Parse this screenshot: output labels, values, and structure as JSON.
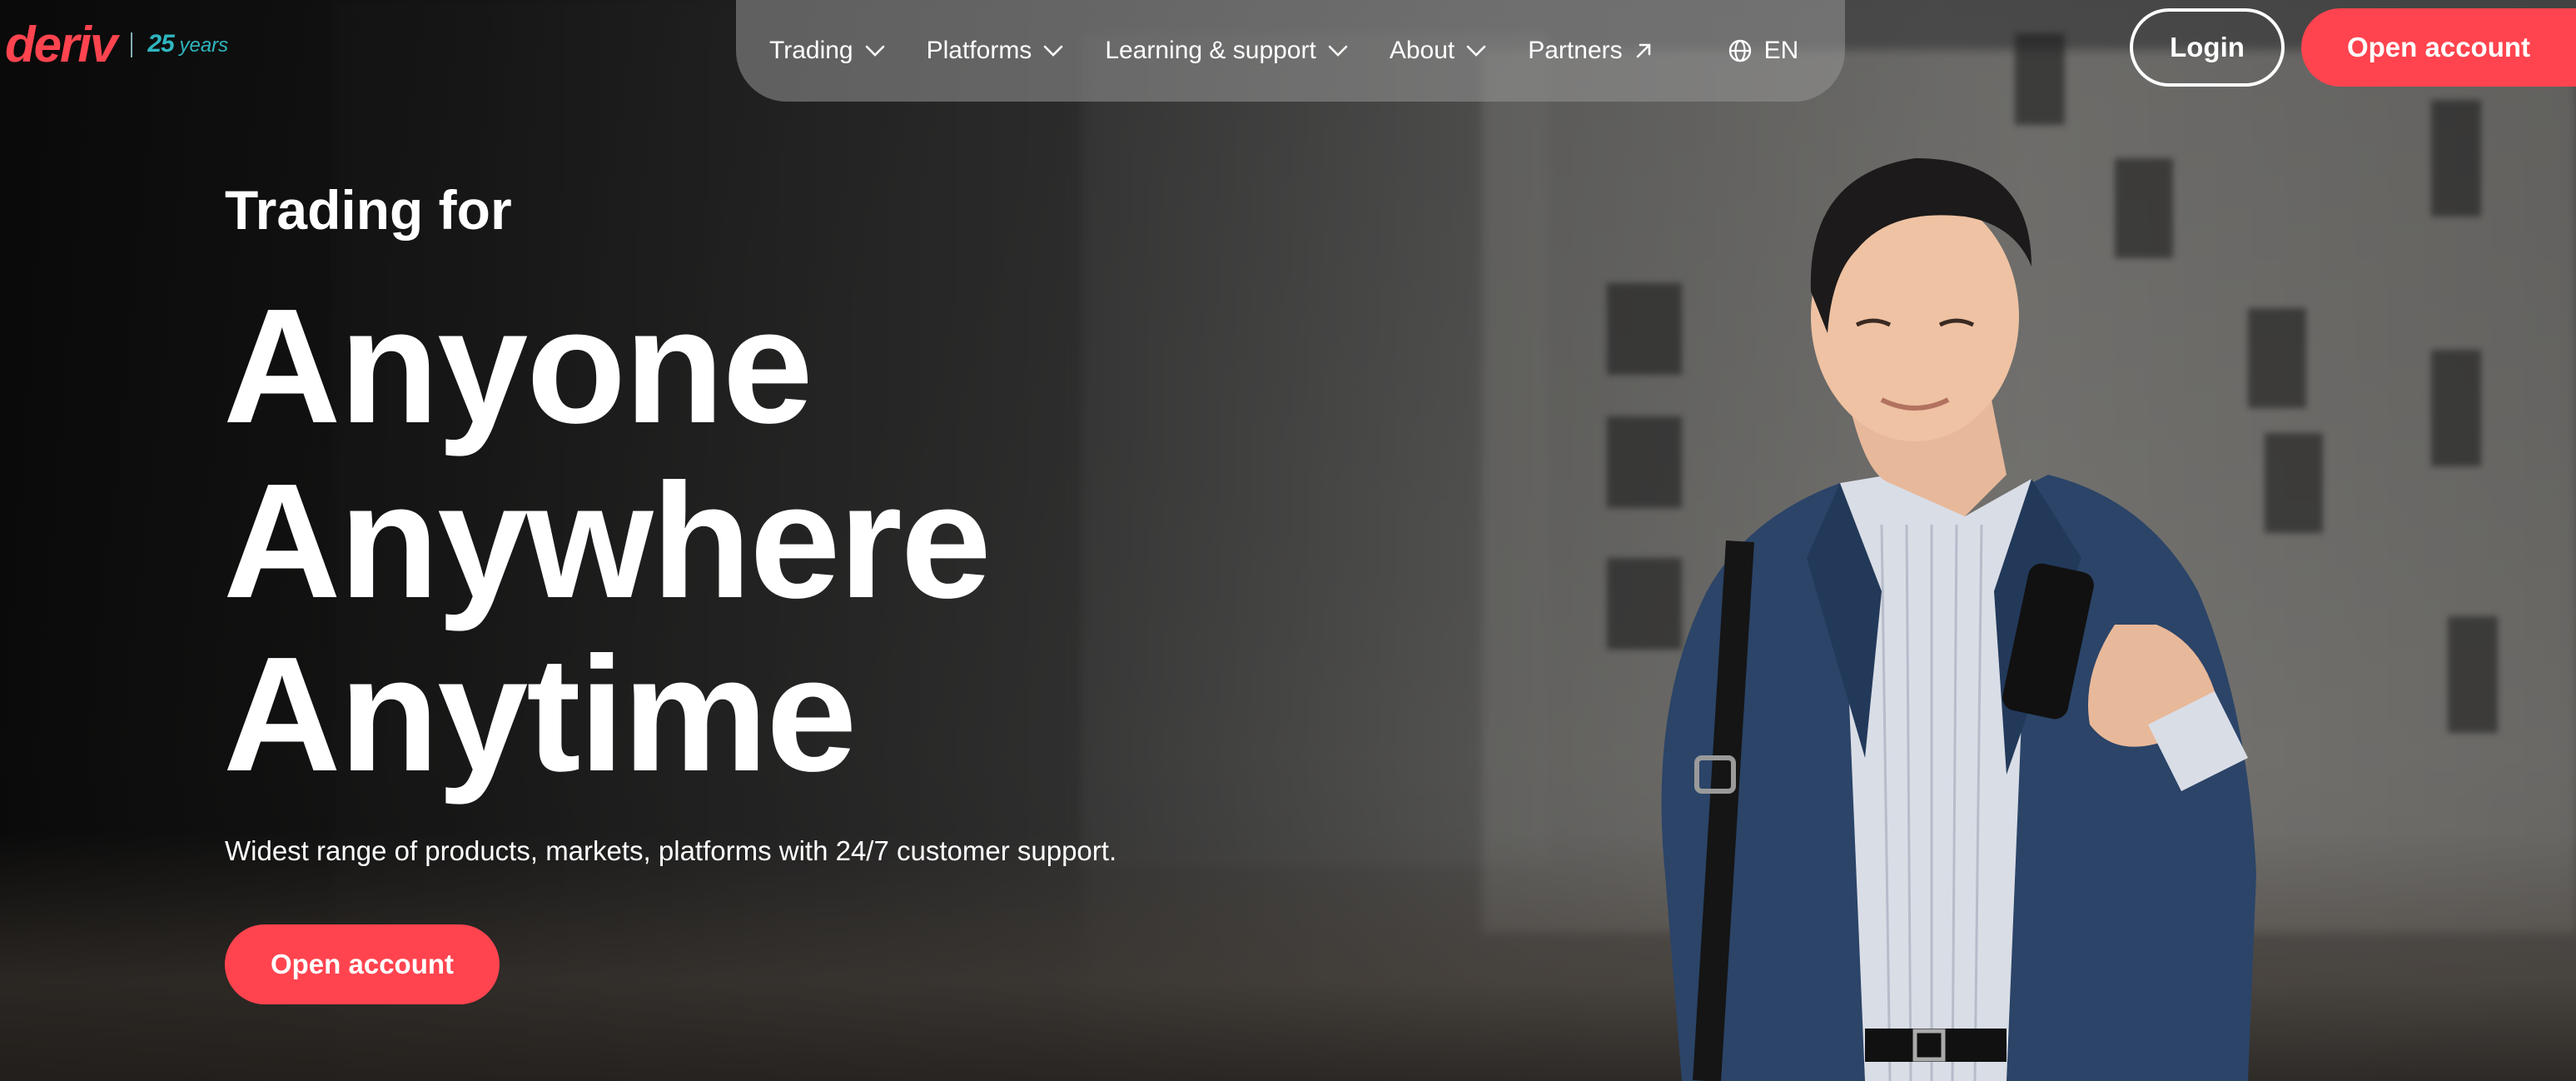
{
  "brand": {
    "logo_text": "deriv",
    "anniversary_number": "25",
    "anniversary_text": "years",
    "accent_color": "#ff444f",
    "anniversary_color": "#2fb6c0"
  },
  "nav": {
    "items": [
      {
        "label": "Trading",
        "icon": "chevron-down-icon"
      },
      {
        "label": "Platforms",
        "icon": "chevron-down-icon"
      },
      {
        "label": "Learning & support",
        "icon": "chevron-down-icon"
      },
      {
        "label": "About",
        "icon": "chevron-down-icon"
      },
      {
        "label": "Partners",
        "icon": "external-arrow-icon"
      }
    ],
    "language": {
      "label": "EN",
      "icon": "globe-icon"
    }
  },
  "header_actions": {
    "login_label": "Login",
    "open_account_label": "Open account"
  },
  "hero": {
    "kicker": "Trading for",
    "lines": [
      "Anyone",
      "Anywhere",
      "Anytime"
    ],
    "description": "Widest range of products, markets, platforms with 24/7 customer support.",
    "cta_label": "Open account"
  }
}
